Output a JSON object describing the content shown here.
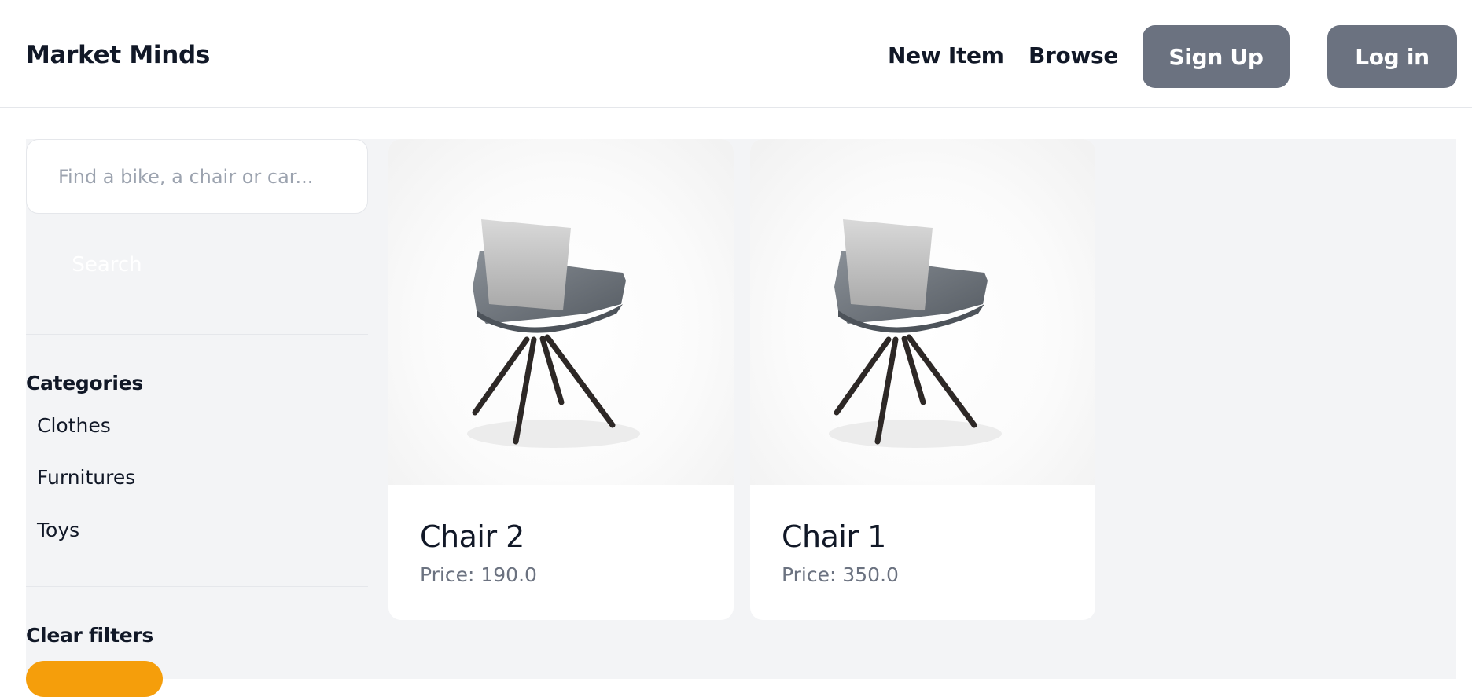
{
  "header": {
    "brand": "Market Minds",
    "nav_links": [
      "New Item",
      "Browse"
    ],
    "signup_label": "Sign Up",
    "login_label": "Log in"
  },
  "sidebar": {
    "search_placeholder": "Find a bike, a chair or car...",
    "search_button_label": "Search",
    "categories_heading": "Categories",
    "categories": [
      "Clothes",
      "Furnitures",
      "Toys"
    ],
    "clear_filters_heading": "Clear filters"
  },
  "items": [
    {
      "name": "Chair 2",
      "price": "Price: 190.0",
      "image_icon": "chair-image"
    },
    {
      "name": "Chair 1",
      "price": "Price: 350.0",
      "image_icon": "chair-image"
    }
  ],
  "colors": {
    "nav_button_bg": "#6b7280",
    "content_bg": "#f3f4f6",
    "clear_button_bg": "#f59e0b",
    "price_text": "#6b7280"
  }
}
